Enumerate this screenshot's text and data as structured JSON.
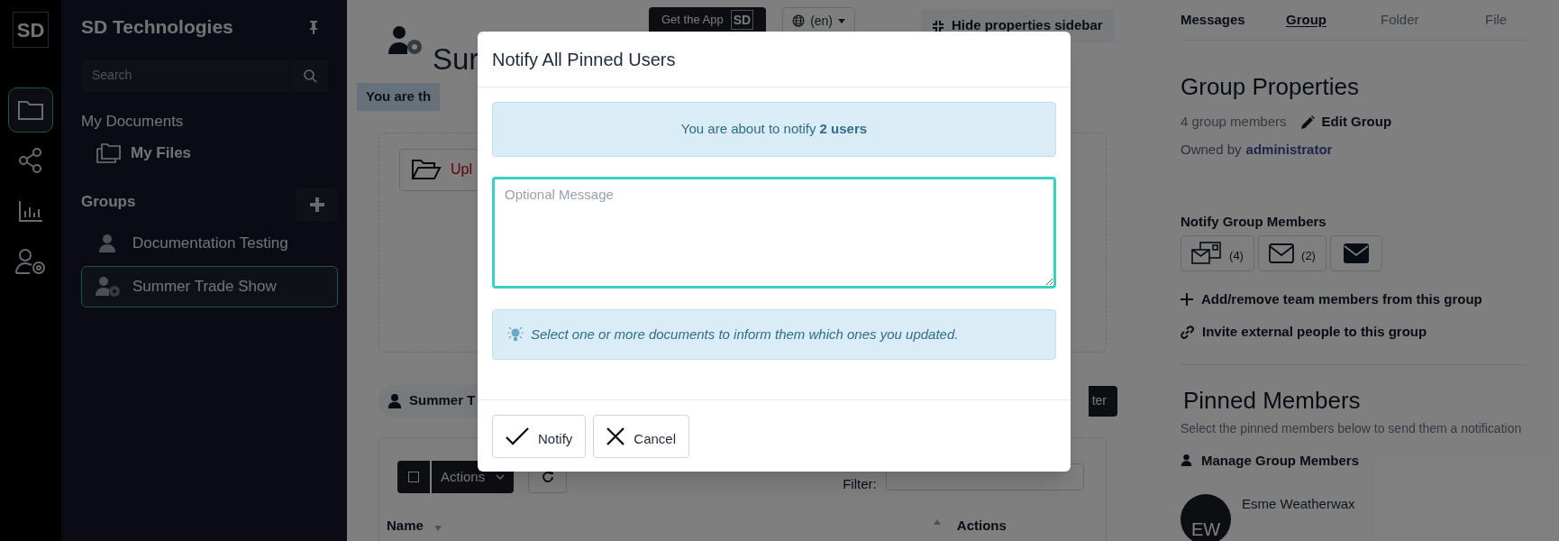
{
  "rail": {
    "logo": "SD",
    "items": [
      {
        "kind": "folder",
        "selected": true
      },
      {
        "kind": "share",
        "selected": false
      },
      {
        "kind": "chart",
        "selected": false
      },
      {
        "kind": "user-gear",
        "selected": false
      }
    ]
  },
  "sidebar": {
    "title": "SD Technologies",
    "search": {
      "placeholder": "Search"
    },
    "my_documents": {
      "heading": "My Documents",
      "items": [
        {
          "label": "My Files"
        }
      ]
    },
    "groups": {
      "heading": "Groups",
      "items": [
        {
          "label": "Documentation Testing",
          "kind": "group",
          "selected": false
        },
        {
          "label": "Summer Trade Show",
          "kind": "admin-group",
          "selected": true
        }
      ]
    }
  },
  "topbar": {
    "app_button": {
      "label": "Get the App",
      "logo": "SD"
    },
    "language": "(en)",
    "hide_sidebar": "Hide properties sidebar"
  },
  "main": {
    "title": "Sur",
    "role_badge": "You are th",
    "upload_button": "Upl",
    "group_chip": "Summer T",
    "dark_button": "ter",
    "toolbar": {
      "select_all": {
        "checked": false
      },
      "actions": "Actions",
      "filter_label": "Filter:"
    },
    "table": {
      "columns": [
        "Name",
        "Actions"
      ]
    }
  },
  "modal": {
    "title": "Notify All Pinned Users",
    "notice": "You are about to notify **2 users**",
    "message": {
      "placeholder": "Optional Message"
    },
    "hint": "Select one or more documents to inform them which ones you updated.",
    "buttons": [
      {
        "label": "Notify",
        "kind": "confirm"
      },
      {
        "label": "Cancel",
        "kind": "cancel"
      }
    ]
  },
  "properties": {
    "tabs": [
      {
        "label": "Messages",
        "selected": false,
        "disabled": false
      },
      {
        "label": "Group",
        "selected": true,
        "disabled": false
      },
      {
        "label": "Folder",
        "selected": false,
        "disabled": true
      },
      {
        "label": "File",
        "selected": false,
        "disabled": true
      }
    ],
    "heading": "Group Properties",
    "member_count": "4 group members",
    "edit": "Edit Group",
    "owner_prefix": "Owned by",
    "owner_link": "administrator",
    "notify": {
      "heading": "Notify Group Members",
      "buttons": [
        {
          "kind": "multi",
          "count": "(4)"
        },
        {
          "kind": "envelope",
          "count": "(2)"
        },
        {
          "kind": "envelope-filled"
        }
      ]
    },
    "links": [
      {
        "kind": "add",
        "label": "Add/remove team members from this group"
      },
      {
        "kind": "invite",
        "label": "Invite external people to this group"
      }
    ],
    "pinned": {
      "heading": "Pinned Members",
      "description": "Select the pinned members below to send them a notification",
      "manage": "Manage Group Members",
      "members": [
        {
          "initials": "EW",
          "name": "Esme Weatherwax"
        }
      ]
    }
  }
}
